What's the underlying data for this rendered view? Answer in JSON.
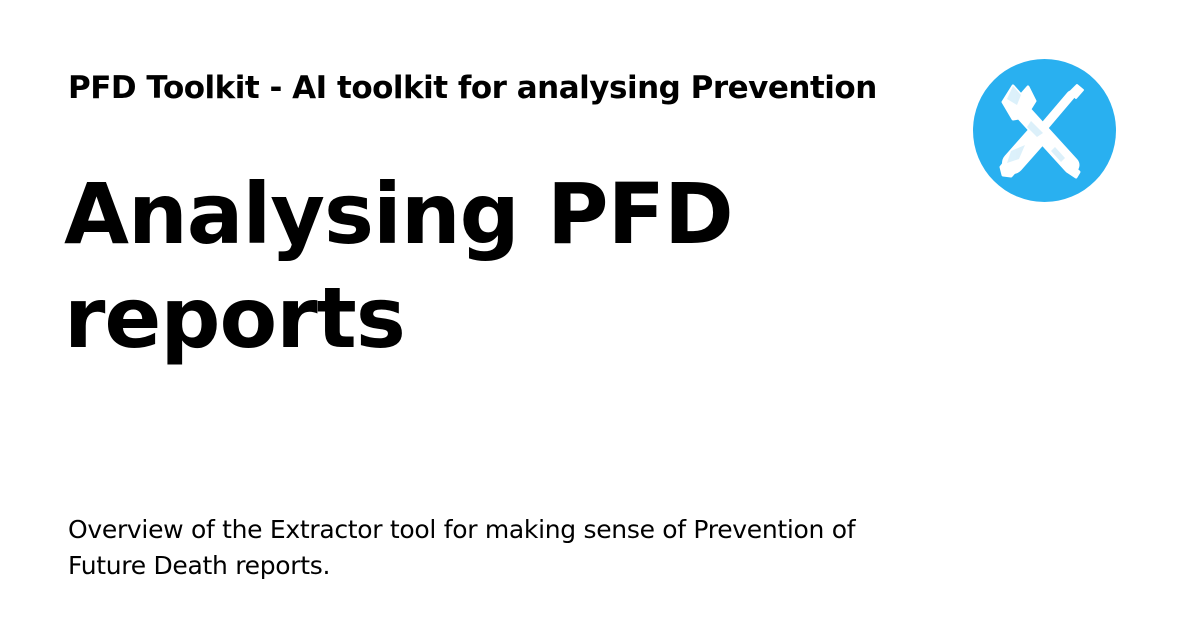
{
  "header": {
    "site_name": "PFD Toolkit - AI toolkit for analysing Prevention"
  },
  "main": {
    "title_line1": "Analysing PFD",
    "title_line2": "reports",
    "description_line1": "Overview of the Extractor tool for making sense of Prevention of",
    "description_line2": "Future Death reports."
  },
  "logo": {
    "icon": "tools-icon",
    "background_color": "#29b0f0",
    "glyph_color": "#ffffff"
  }
}
